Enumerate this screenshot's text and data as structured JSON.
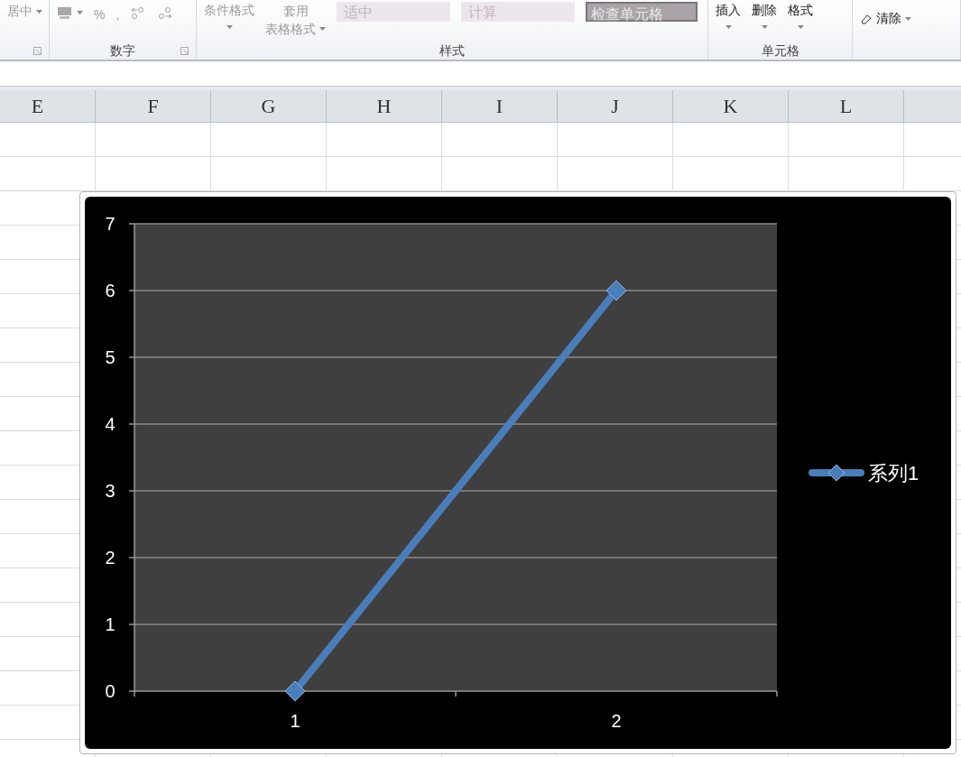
{
  "ribbon": {
    "groups": [
      {
        "items": [
          {
            "kind": "text",
            "text": "居中",
            "disabled": true
          }
        ],
        "launcher": true
      },
      {
        "label": "数字",
        "items": [
          {
            "kind": "currency",
            "disabled": true
          },
          {
            "kind": "symbol",
            "text": "%",
            "disabled": true
          },
          {
            "kind": "symbol",
            "text": ",",
            "disabled": true
          },
          {
            "kind": "increase-decimal",
            "disabled": true
          },
          {
            "kind": "decrease-decimal",
            "disabled": true
          }
        ],
        "launcher": true
      },
      {
        "label": "样式",
        "items": [
          {
            "kind": "stacked",
            "text": "条件格式",
            "disabled": true
          },
          {
            "kind": "stacked2",
            "text": "套用",
            "text2": "表格格式",
            "disabled": true
          },
          {
            "kind": "style",
            "text": "适中"
          },
          {
            "kind": "style",
            "text": "计算"
          },
          {
            "kind": "style-dark",
            "text": "检查单元格"
          }
        ],
        "launcher": false
      },
      {
        "label": "单元格",
        "items": [
          {
            "kind": "stacked",
            "text": "插入",
            "disabled": false
          },
          {
            "kind": "stacked",
            "text": "删除",
            "disabled": false
          },
          {
            "kind": "stacked",
            "text": "格式",
            "disabled": false
          }
        ],
        "launcher": false
      },
      {
        "items": [
          {
            "kind": "eraser",
            "text": "清除",
            "disabled": false
          }
        ],
        "launcher": false
      }
    ]
  },
  "sheet": {
    "columns": [
      "E",
      "F",
      "G",
      "H",
      "I",
      "J",
      "K",
      "L"
    ]
  },
  "chart": {
    "chart_data": {
      "type": "line",
      "categories": [
        "1",
        "2"
      ],
      "series": [
        {
          "name": "系列1",
          "color": "#4a7ebb",
          "marker": "diamond",
          "values": [
            0,
            6
          ]
        }
      ],
      "ylim": [
        0,
        7
      ],
      "yticks": [
        0,
        1,
        2,
        3,
        4,
        5,
        6,
        7
      ],
      "grid": true
    }
  }
}
